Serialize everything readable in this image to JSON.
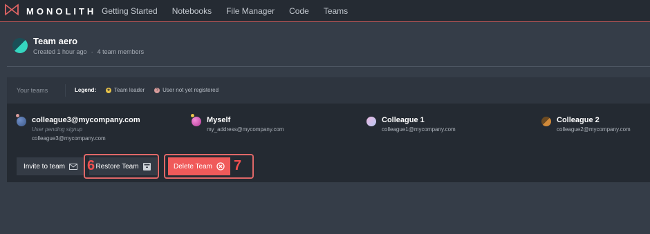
{
  "nav": {
    "brand": "MONOLITH",
    "links": [
      "Getting Started",
      "Notebooks",
      "File Manager",
      "Code",
      "Teams"
    ]
  },
  "team": {
    "name": "Team aero",
    "created": "Created 1 hour ago",
    "members_count": "4 team members"
  },
  "panel": {
    "tab_label": "Your teams",
    "legend": {
      "title": "Legend:",
      "leader": "Team leader",
      "pending": "User not yet registered"
    },
    "members": [
      {
        "name": "colleague3@mycompany.com",
        "note": "User pending signup",
        "email": "colleague3@mycompany.com",
        "avatar_color": "#3d5a8a",
        "badge": "pending"
      },
      {
        "name": "Myself",
        "email": "my_address@mycompany.com",
        "avatar_color": "#d64fb3",
        "badge": "leader"
      },
      {
        "name": "Colleague 1",
        "email": "colleague1@mycompany.com",
        "avatar_color": "#c9c4ef"
      },
      {
        "name": "Colleague 2",
        "email": "colleague2@mycompany.com",
        "avatar_color": "#c47a33"
      }
    ],
    "buttons": {
      "invite": "Invite to team",
      "restore": "Restore Team",
      "delete": "Delete Team"
    }
  },
  "callouts": {
    "restore_number": "6",
    "delete_number": "7"
  },
  "colors": {
    "accent": "#f05a5a",
    "leader": "#e8c34a",
    "pending": "#d79b9b",
    "teal": "#35d6c0"
  },
  "icons": [
    "monolith-logo-icon",
    "envelope-icon",
    "archive-box-icon",
    "close-circle-icon"
  ]
}
